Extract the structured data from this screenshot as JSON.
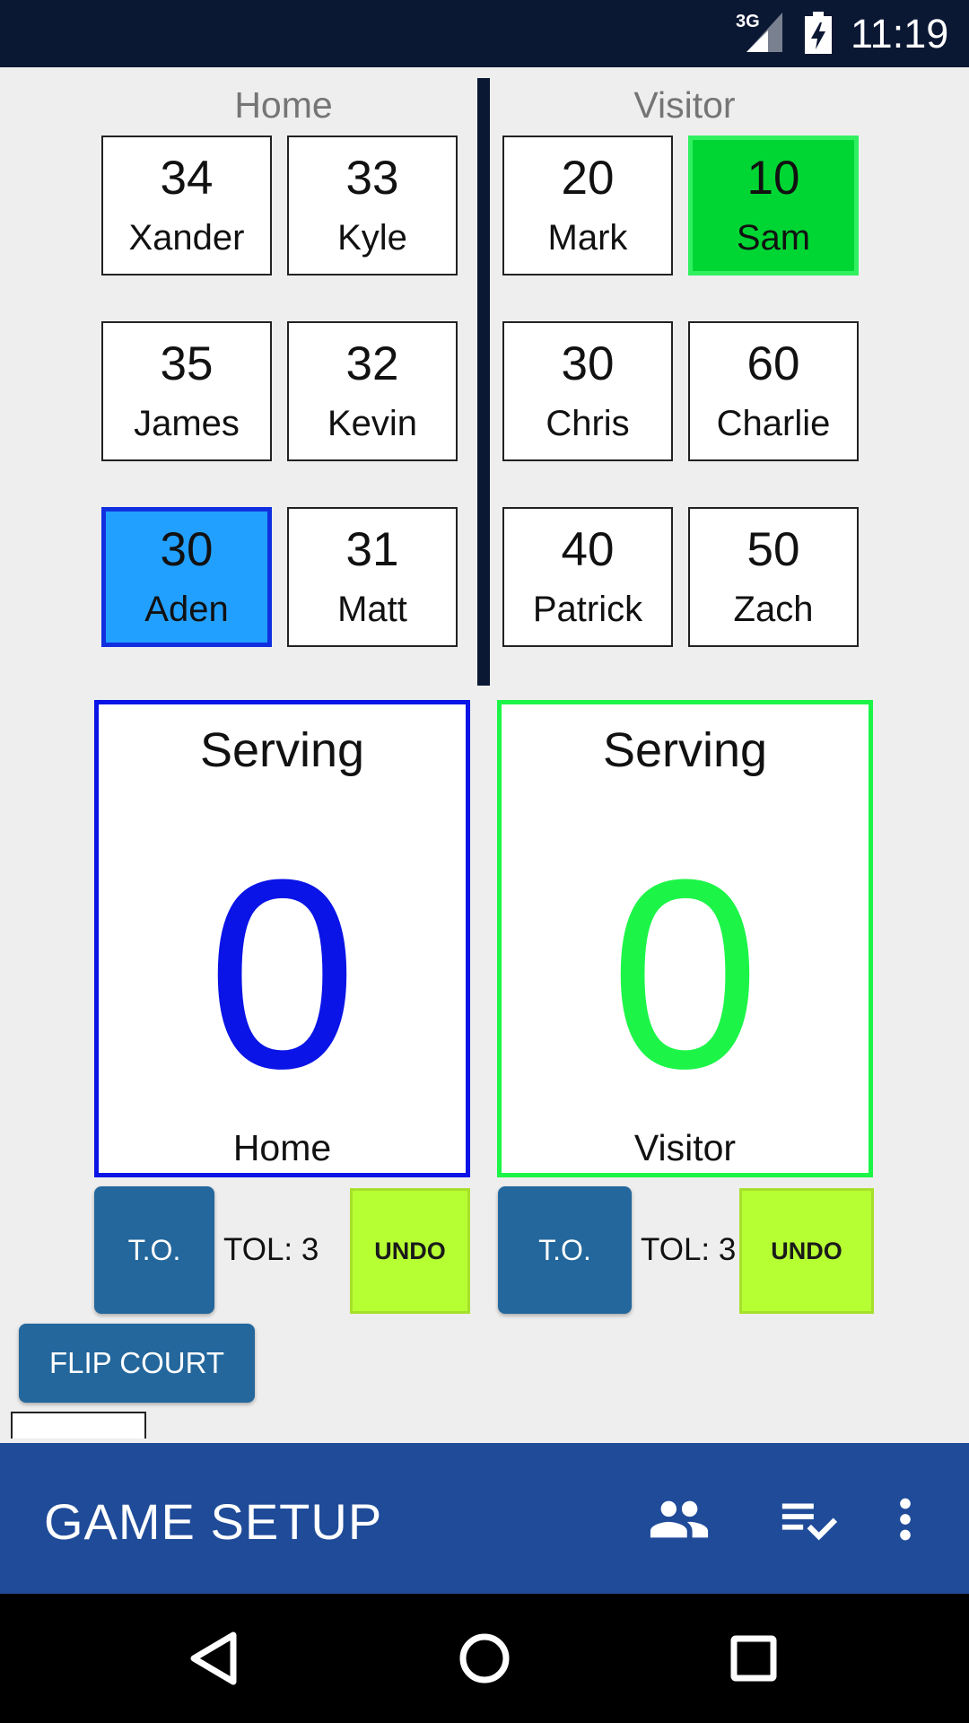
{
  "status_bar": {
    "network": "3G",
    "time": "11:19"
  },
  "home": {
    "header": "Home",
    "players": [
      {
        "number": "34",
        "name": "Xander"
      },
      {
        "number": "33",
        "name": "Kyle"
      },
      {
        "number": "35",
        "name": "James"
      },
      {
        "number": "32",
        "name": "Kevin"
      },
      {
        "number": "30",
        "name": "Aden"
      },
      {
        "number": "31",
        "name": "Matt"
      }
    ],
    "selected_player_name": "Aden",
    "serving_label": "Serving",
    "score": "0",
    "team_label": "Home",
    "to_label": "T.O.",
    "tol_label": "TOL: 3",
    "undo_label": "UNDO",
    "color": "#0a14e6"
  },
  "visitor": {
    "header": "Visitor",
    "players": [
      {
        "number": "20",
        "name": "Mark"
      },
      {
        "number": "10",
        "name": "Sam"
      },
      {
        "number": "30",
        "name": "Chris"
      },
      {
        "number": "60",
        "name": "Charlie"
      },
      {
        "number": "40",
        "name": "Patrick"
      },
      {
        "number": "50",
        "name": "Zach"
      }
    ],
    "selected_player_name": "Sam",
    "serving_label": "Serving",
    "score": "0",
    "team_label": "Visitor",
    "to_label": "T.O.",
    "tol_label": "TOL: 3",
    "undo_label": "UNDO",
    "color": "#1cf548"
  },
  "flip_court_label": "FLIP COURT",
  "app_bar": {
    "title": "GAME SETUP",
    "icons": [
      "people-icon",
      "playlist-check-icon",
      "more-vert-icon"
    ],
    "color": "#1f4b99"
  },
  "nav_bar": {
    "icons": [
      "back-icon",
      "home-icon",
      "recents-icon"
    ]
  }
}
